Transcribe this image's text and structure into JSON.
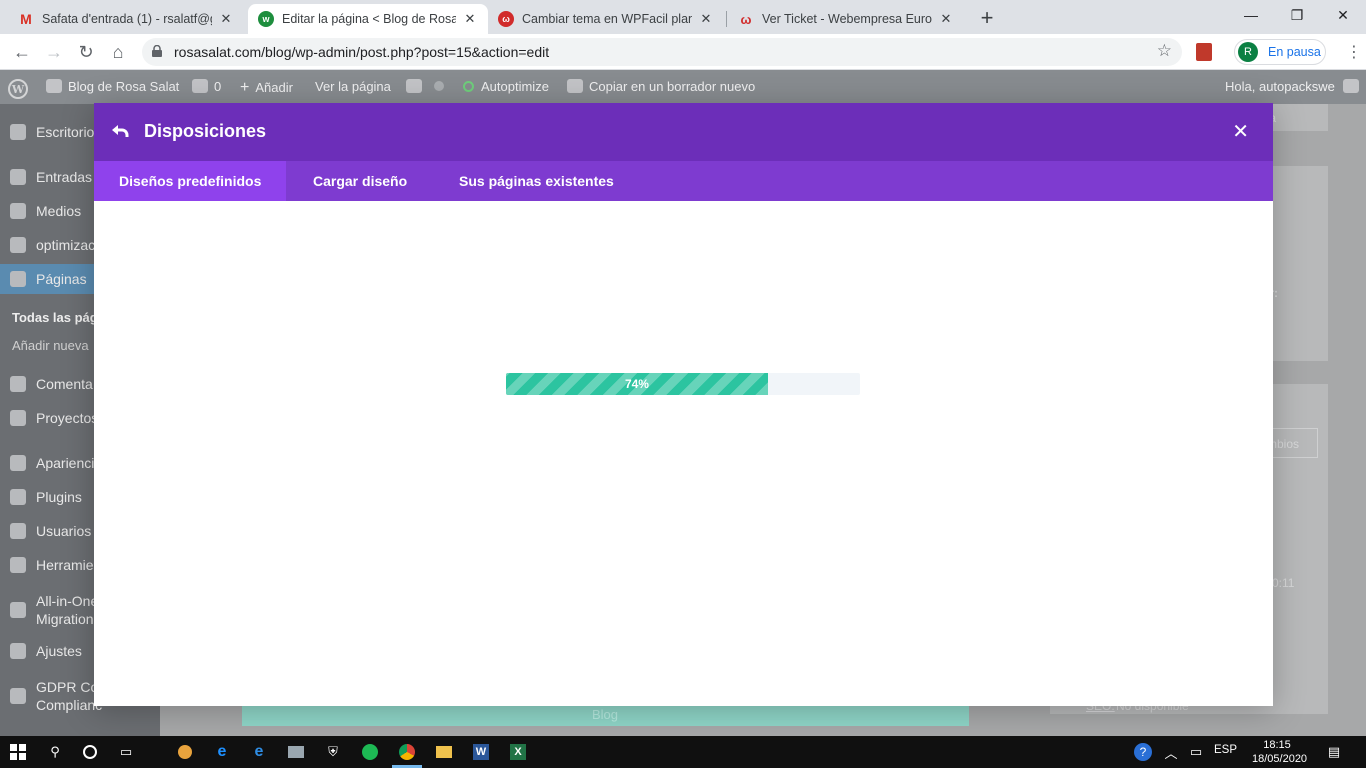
{
  "browser": {
    "tabs": [
      {
        "title": "Safata d'entrada (1) - rsalatf@gm",
        "favicon": "gmail-icon",
        "active": false
      },
      {
        "title": "Editar la página < Blog de Rosa S",
        "favicon": "webempresa-icon",
        "active": true
      },
      {
        "title": "Cambiar tema en WPFacil plantill",
        "favicon": "webempresa-icon",
        "active": false
      },
      {
        "title": "Ver Ticket - Webempresa Europa",
        "favicon": "webempresa-icon",
        "active": false
      }
    ],
    "url": "rosasalat.com/blog/wp-admin/post.php?post=15&action=edit",
    "profile_initial": "R",
    "profile_status": "En pausa"
  },
  "adminbar": {
    "site_name": "Blog de Rosa Salat",
    "comments_count": "0",
    "add_new": "Añadir",
    "view_page": "Ver la página",
    "autoptimize": "Autoptimize",
    "copy_draft": "Copiar en un borrador nuevo",
    "greeting": "Hola, autopackswe"
  },
  "sidebar": {
    "items": [
      {
        "label": "Escritorio"
      },
      {
        "label": "Entradas"
      },
      {
        "label": "Medios"
      },
      {
        "label": "optimizac"
      },
      {
        "label": "Páginas"
      },
      {
        "label": "Comenta"
      },
      {
        "label": "Proyectos"
      },
      {
        "label": "Aparienci"
      },
      {
        "label": "Plugins"
      },
      {
        "label": "Usuarios"
      },
      {
        "label": "Herramie"
      },
      {
        "label": "All-in-One Migration"
      },
      {
        "label": "Ajustes"
      },
      {
        "label": "GDPR Co Complianc"
      }
    ],
    "sub_all_pages": "Todas las pág",
    "sub_add_new": "Añadir nueva"
  },
  "background": {
    "help": "uda",
    "replace": "azar:",
    "changes": "mbios",
    "time": "0:11",
    "seo_label": "SEO:",
    "seo_status": "No disponible",
    "blog_module": "Blog"
  },
  "modal": {
    "title": "Disposiciones",
    "tabs": [
      {
        "label": "Diseños predefinidos",
        "active": true
      },
      {
        "label": "Cargar diseño",
        "active": false
      },
      {
        "label": "Sus páginas existentes",
        "active": false
      }
    ],
    "progress": 74,
    "progress_label": "74%",
    "colors": {
      "header": "#6c2eb9",
      "tabs": "#7e3bd0",
      "active_tab": "#8f42ec",
      "progress": "#2cc4a0"
    }
  },
  "taskbar": {
    "language": "ESP",
    "time": "18:15",
    "date": "18/05/2020"
  }
}
